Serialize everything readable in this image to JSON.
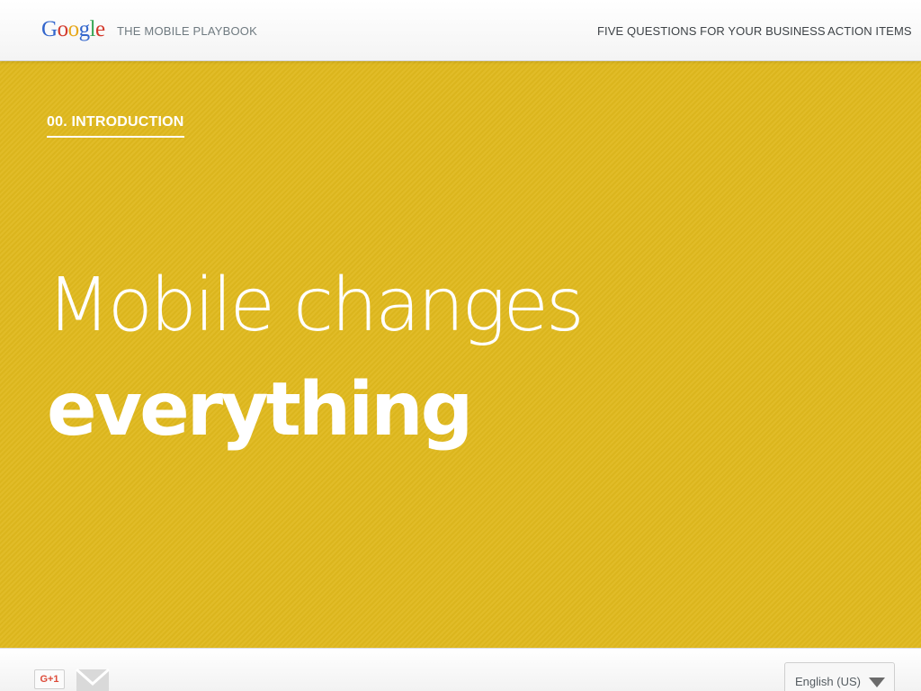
{
  "header": {
    "logo_letters": [
      {
        "char": "G",
        "color": "#3366cc"
      },
      {
        "char": "o",
        "color": "#d33a2c"
      },
      {
        "char": "o",
        "color": "#e7a81b"
      },
      {
        "char": "g",
        "color": "#3366cc"
      },
      {
        "char": "l",
        "color": "#3aa757"
      },
      {
        "char": "e",
        "color": "#d33a2c"
      }
    ],
    "logo_text": "Google",
    "site_title": "THE MOBILE PLAYBOOK",
    "nav": [
      {
        "label": "FIVE QUESTIONS FOR YOUR BUSINESS"
      },
      {
        "label": "ACTION ITEMS"
      }
    ]
  },
  "hero": {
    "section_label": "00. INTRODUCTION",
    "headline_line1": "Mobile changes",
    "headline_line2": "everything",
    "background_color": "#e0b91e"
  },
  "footer": {
    "gplus_label": "G+1",
    "mail_icon": "mail-icon",
    "language": {
      "selected": "English (US)"
    }
  }
}
